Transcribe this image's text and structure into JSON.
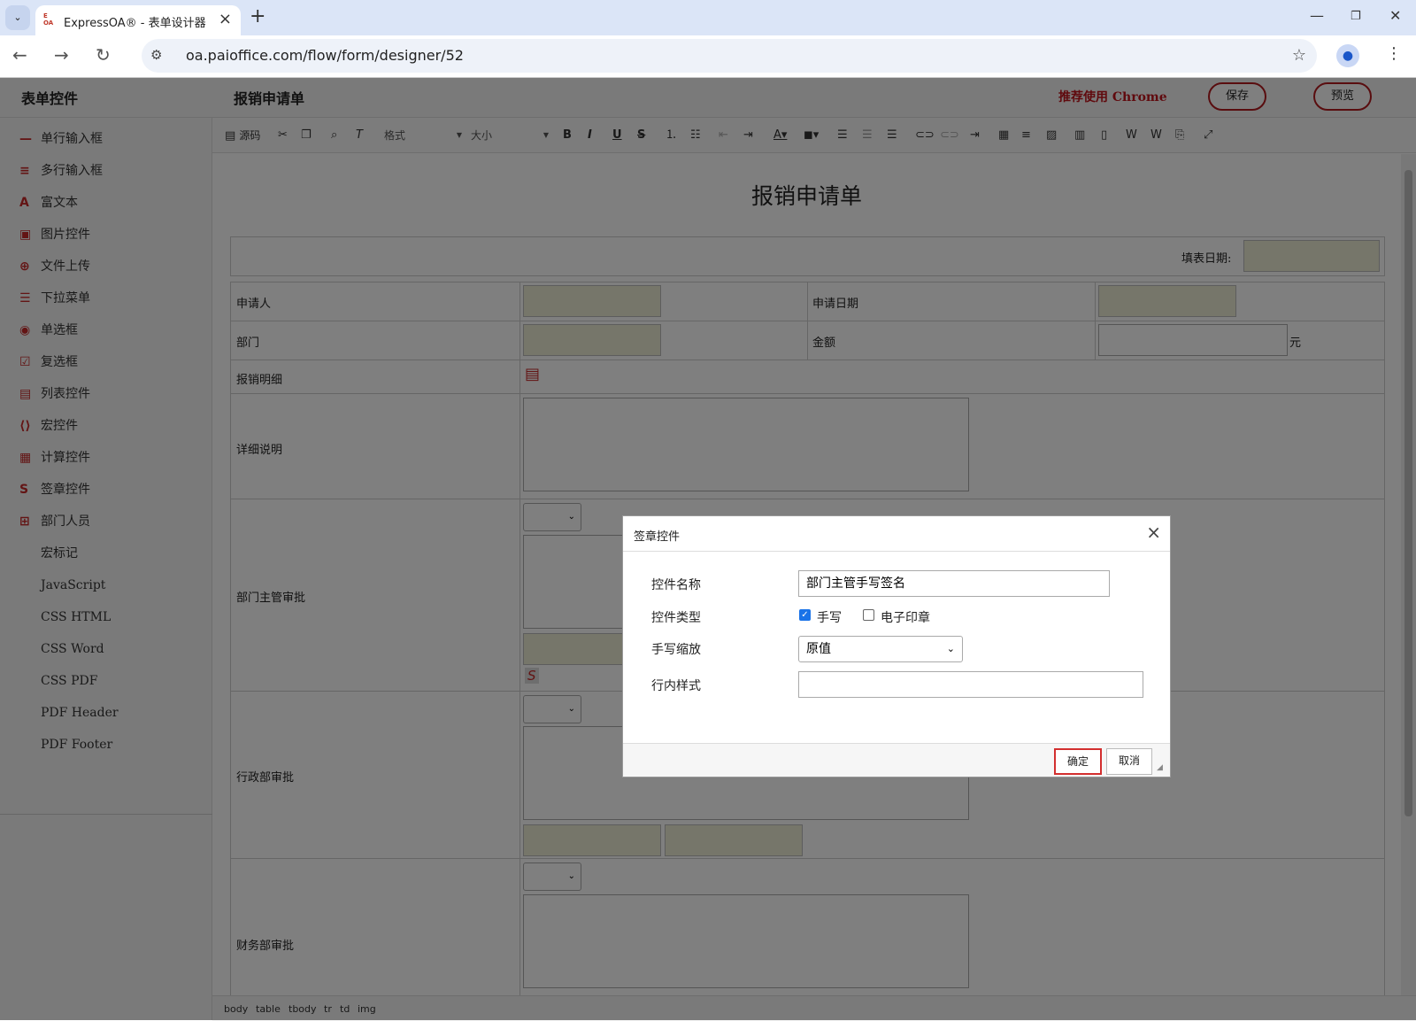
{
  "browser": {
    "tab_title": "ExpressOA® - 表单设计器",
    "favicon_text": "E OA",
    "url": "oa.paioffice.com/flow/form/designer/52"
  },
  "app": {
    "sidebar_title": "表单控件",
    "doc_title": "报销申请单",
    "recommend": "推荐使用 Chrome",
    "save_label": "保存",
    "preview_label": "预览"
  },
  "sidebar": {
    "items": [
      {
        "label": "单行输入框",
        "icon": "single-line-icon",
        "glyph": "—"
      },
      {
        "label": "多行输入框",
        "icon": "multi-line-icon",
        "glyph": "≡"
      },
      {
        "label": "富文本",
        "icon": "rich-text-icon",
        "glyph": "A"
      },
      {
        "label": "图片控件",
        "icon": "image-icon",
        "glyph": "▣"
      },
      {
        "label": "文件上传",
        "icon": "file-upload-icon",
        "glyph": "⊕"
      },
      {
        "label": "下拉菜单",
        "icon": "dropdown-icon",
        "glyph": "☰"
      },
      {
        "label": "单选框",
        "icon": "radio-icon",
        "glyph": "◉"
      },
      {
        "label": "复选框",
        "icon": "checkbox-icon",
        "glyph": "☑"
      },
      {
        "label": "列表控件",
        "icon": "list-icon",
        "glyph": "▤"
      },
      {
        "label": "宏控件",
        "icon": "macro-icon",
        "glyph": "⟨⟩"
      },
      {
        "label": "计算控件",
        "icon": "calculator-icon",
        "glyph": "▦"
      },
      {
        "label": "签章控件",
        "icon": "signature-icon",
        "glyph": "S"
      },
      {
        "label": "部门人员",
        "icon": "department-user-icon",
        "glyph": "⊞"
      },
      {
        "label": "宏标记",
        "icon": "",
        "glyph": ""
      },
      {
        "label": "JavaScript",
        "icon": "",
        "glyph": ""
      },
      {
        "label": "CSS HTML",
        "icon": "",
        "glyph": ""
      },
      {
        "label": "CSS Word",
        "icon": "",
        "glyph": ""
      },
      {
        "label": "CSS PDF",
        "icon": "",
        "glyph": ""
      },
      {
        "label": "PDF Header",
        "icon": "",
        "glyph": ""
      },
      {
        "label": "PDF Footer",
        "icon": "",
        "glyph": ""
      }
    ]
  },
  "toolbar": {
    "source_label": "源码",
    "format_label": "格式",
    "size_label": "大小"
  },
  "form": {
    "title": "报销申请单",
    "fill_date_label": "填表日期:",
    "applicant_label": "申请人",
    "apply_date_label": "申请日期",
    "department_label": "部门",
    "amount_label": "金额",
    "amount_unit": "元",
    "detail_list_label": "报销明细",
    "description_label": "详细说明",
    "dept_manager_label": "部门主管审批",
    "admin_label": "行政部审批",
    "finance_label": "财务部审批"
  },
  "statusbar": {
    "crumbs": [
      "body",
      "table",
      "tbody",
      "tr",
      "td",
      "img"
    ]
  },
  "dialog": {
    "title": "签章控件",
    "name_label": "控件名称",
    "name_value": "部门主管手写签名",
    "type_label": "控件类型",
    "type_handwrite": "手写",
    "type_handwrite_checked": true,
    "type_seal": "电子印章",
    "type_seal_checked": false,
    "scale_label": "手写缩放",
    "scale_value": "原值",
    "style_label": "行内样式",
    "style_value": "",
    "ok_label": "确定",
    "cancel_label": "取消"
  },
  "colors": {
    "accent": "#c0141c",
    "input_fill": "#ecedd4"
  }
}
